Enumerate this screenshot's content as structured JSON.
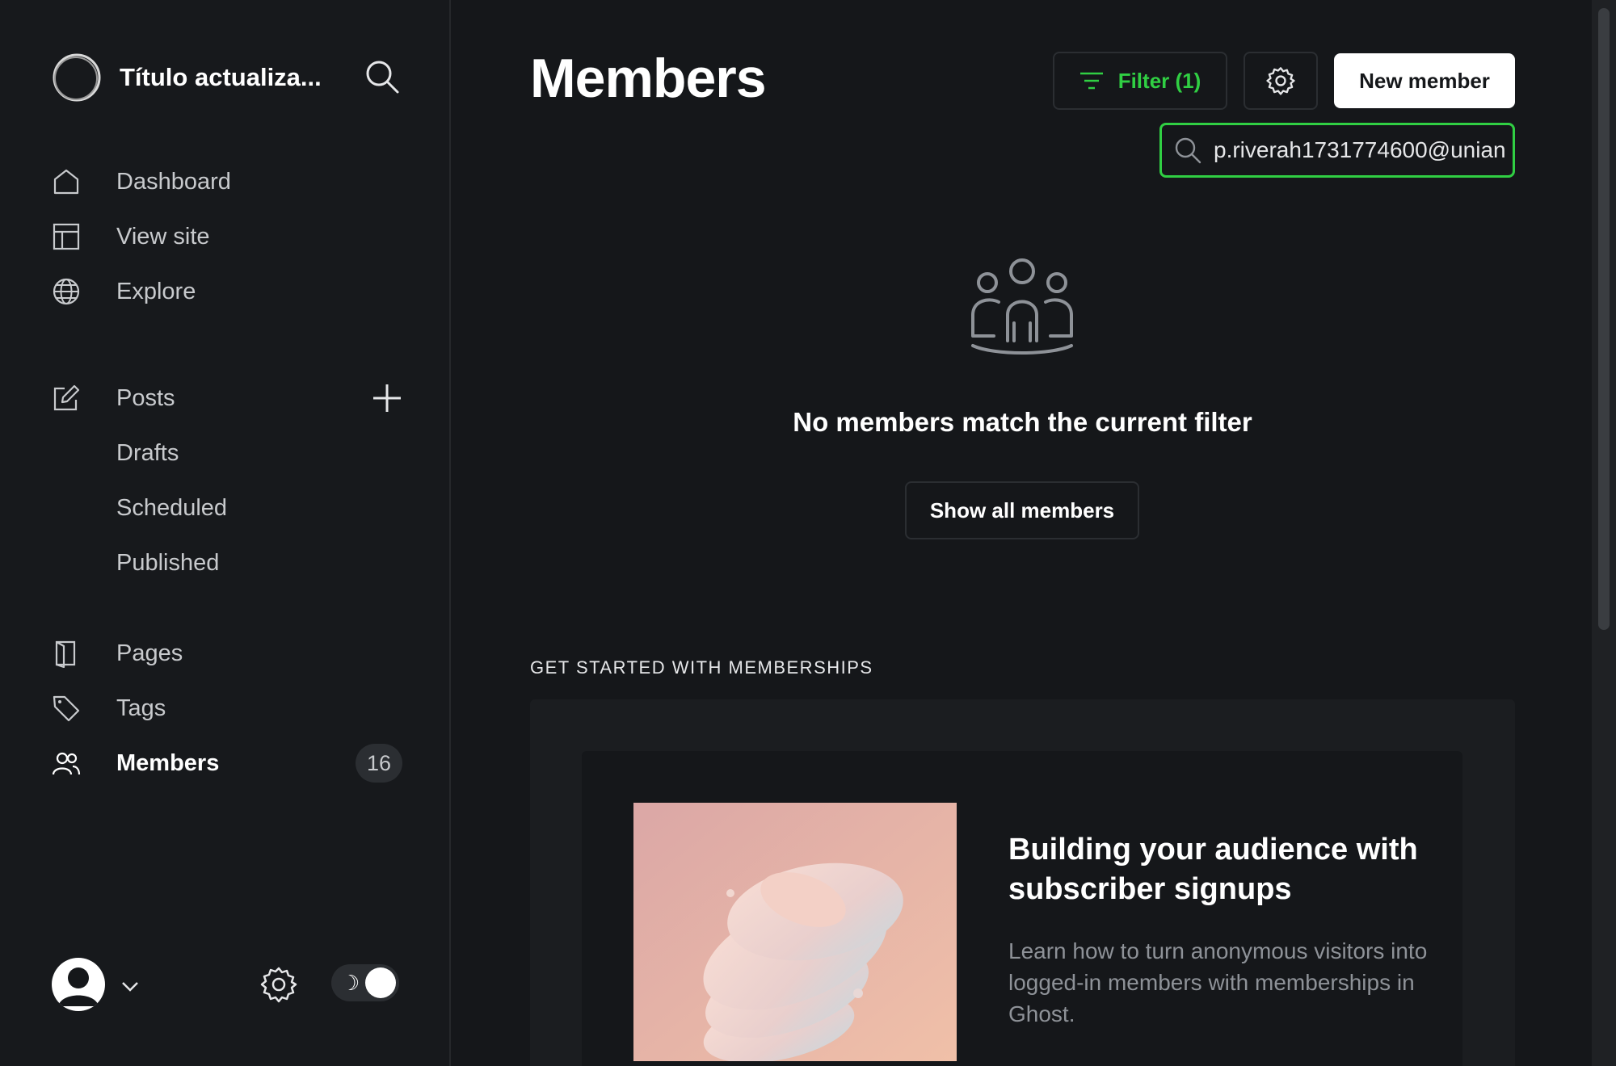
{
  "sidebar": {
    "site_title": "Título actualiza...",
    "nav": [
      {
        "label": "Dashboard",
        "icon": "home-icon"
      },
      {
        "label": "View site",
        "icon": "layout-icon"
      },
      {
        "label": "Explore",
        "icon": "globe-icon"
      }
    ],
    "posts": {
      "label": "Posts",
      "icon": "edit-icon",
      "sub": [
        "Drafts",
        "Scheduled",
        "Published"
      ]
    },
    "pages": {
      "label": "Pages",
      "icon": "page-icon"
    },
    "tags": {
      "label": "Tags",
      "icon": "tag-icon"
    },
    "members": {
      "label": "Members",
      "icon": "members-icon",
      "count": "16"
    },
    "theme_icon": "☽"
  },
  "main": {
    "title": "Members",
    "filter_label": "Filter (1)",
    "new_member_label": "New member",
    "search_value": "p.riverah1731774600@unian",
    "empty_message": "No members match the current filter",
    "show_all_label": "Show all members",
    "section_label": "GET STARTED WITH MEMBERSHIPS",
    "card": {
      "title": "Building your audience with subscriber signups",
      "description": "Learn how to turn anonymous visitors into logged-in members with memberships in Ghost."
    }
  },
  "colors": {
    "background": "#15171a",
    "accent_green": "#30cf43",
    "primary_button": "#ffffff"
  }
}
